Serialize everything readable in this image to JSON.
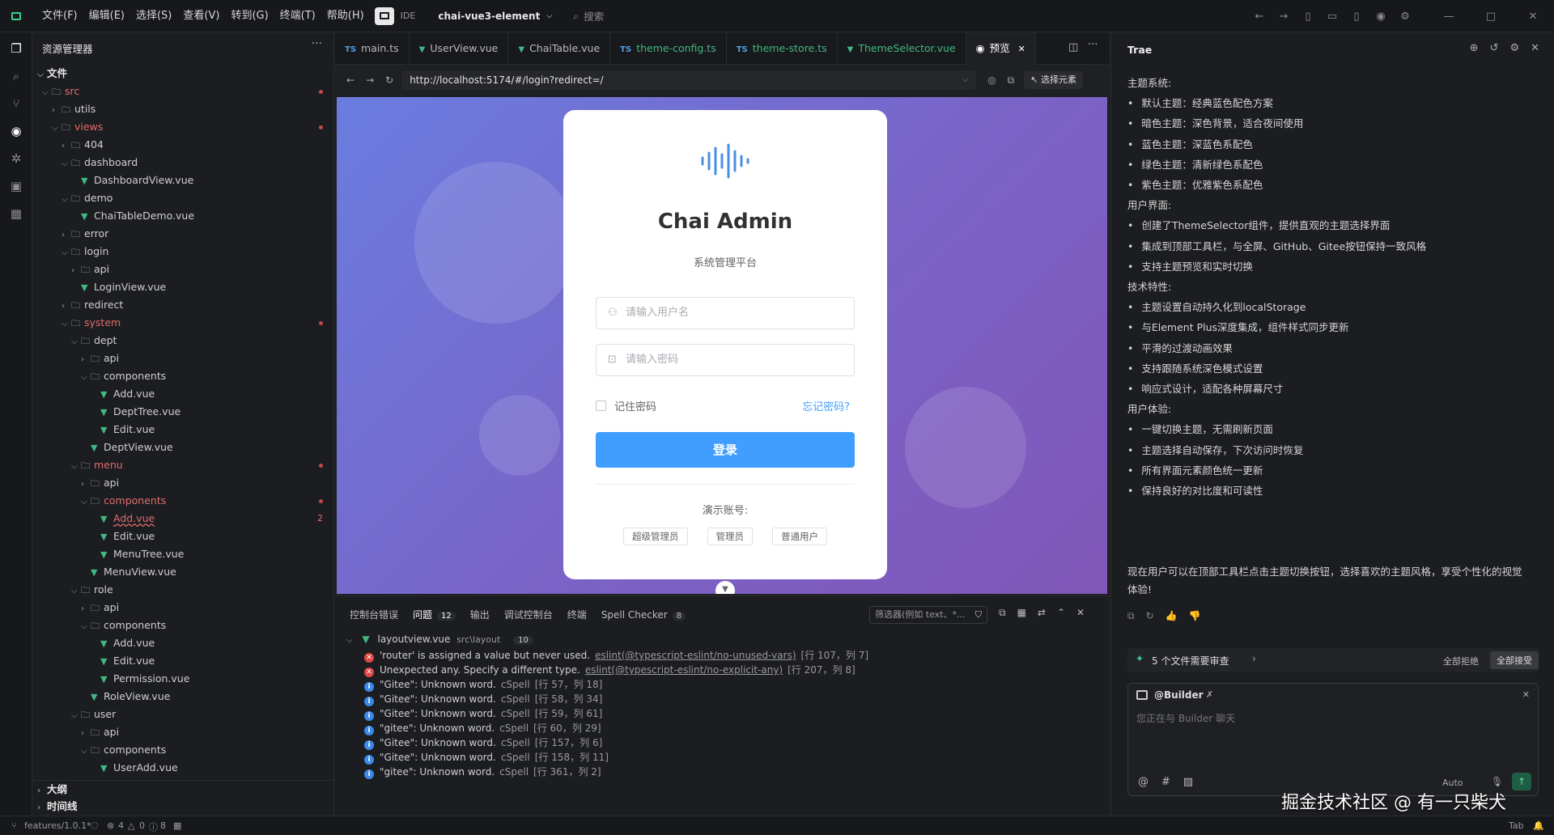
{
  "titlebar": {
    "menus": [
      "文件(F)",
      "编辑(E)",
      "选择(S)",
      "查看(V)",
      "转到(G)",
      "终端(T)",
      "帮助(H)"
    ],
    "ide_label": "IDE",
    "project": "chai-vue3-element",
    "search_placeholder": "搜索"
  },
  "explorer": {
    "title": "资源管理器",
    "section_files": "文件",
    "section_outline": "大纲",
    "section_timeline": "时间线",
    "items": [
      {
        "label": "src",
        "depth": 0,
        "type": "folder",
        "open": true,
        "red": true,
        "dot": true
      },
      {
        "label": "utils",
        "depth": 1,
        "type": "folder",
        "open": false
      },
      {
        "label": "views",
        "depth": 1,
        "type": "folder",
        "open": true,
        "red": true,
        "dot": true
      },
      {
        "label": "404",
        "depth": 2,
        "type": "folder",
        "open": false
      },
      {
        "label": "dashboard",
        "depth": 2,
        "type": "folder",
        "open": true
      },
      {
        "label": "DashboardView.vue",
        "depth": 3,
        "type": "vue"
      },
      {
        "label": "demo",
        "depth": 2,
        "type": "folder",
        "open": true
      },
      {
        "label": "ChaiTableDemo.vue",
        "depth": 3,
        "type": "vue"
      },
      {
        "label": "error",
        "depth": 2,
        "type": "folder",
        "open": false
      },
      {
        "label": "login",
        "depth": 2,
        "type": "folder",
        "open": true
      },
      {
        "label": "api",
        "depth": 3,
        "type": "folder",
        "open": false
      },
      {
        "label": "LoginView.vue",
        "depth": 3,
        "type": "vue"
      },
      {
        "label": "redirect",
        "depth": 2,
        "type": "folder",
        "open": false
      },
      {
        "label": "system",
        "depth": 2,
        "type": "folder",
        "open": true,
        "red": true,
        "dot": true
      },
      {
        "label": "dept",
        "depth": 3,
        "type": "folder",
        "open": true
      },
      {
        "label": "api",
        "depth": 4,
        "type": "folder",
        "open": false
      },
      {
        "label": "components",
        "depth": 4,
        "type": "folder",
        "open": true
      },
      {
        "label": "Add.vue",
        "depth": 5,
        "type": "vue"
      },
      {
        "label": "DeptTree.vue",
        "depth": 5,
        "type": "vue"
      },
      {
        "label": "Edit.vue",
        "depth": 5,
        "type": "vue"
      },
      {
        "label": "DeptView.vue",
        "depth": 4,
        "type": "vue"
      },
      {
        "label": "menu",
        "depth": 3,
        "type": "folder",
        "open": true,
        "red": true,
        "dot": true
      },
      {
        "label": "api",
        "depth": 4,
        "type": "folder",
        "open": false
      },
      {
        "label": "components",
        "depth": 4,
        "type": "folder",
        "open": true,
        "red": true,
        "dot": true
      },
      {
        "label": "Add.vue",
        "depth": 5,
        "type": "vue",
        "red": true,
        "badge": "2"
      },
      {
        "label": "Edit.vue",
        "depth": 5,
        "type": "vue"
      },
      {
        "label": "MenuTree.vue",
        "depth": 5,
        "type": "vue"
      },
      {
        "label": "MenuView.vue",
        "depth": 4,
        "type": "vue"
      },
      {
        "label": "role",
        "depth": 3,
        "type": "folder",
        "open": true
      },
      {
        "label": "api",
        "depth": 4,
        "type": "folder",
        "open": false
      },
      {
        "label": "components",
        "depth": 4,
        "type": "folder",
        "open": true
      },
      {
        "label": "Add.vue",
        "depth": 5,
        "type": "vue"
      },
      {
        "label": "Edit.vue",
        "depth": 5,
        "type": "vue"
      },
      {
        "label": "Permission.vue",
        "depth": 5,
        "type": "vue"
      },
      {
        "label": "RoleView.vue",
        "depth": 4,
        "type": "vue"
      },
      {
        "label": "user",
        "depth": 3,
        "type": "folder",
        "open": true
      },
      {
        "label": "api",
        "depth": 4,
        "type": "folder",
        "open": false
      },
      {
        "label": "components",
        "depth": 4,
        "type": "folder",
        "open": true
      },
      {
        "label": "UserAdd.vue",
        "depth": 5,
        "type": "vue"
      }
    ]
  },
  "tabs": [
    {
      "label": "main.ts",
      "kind": "ts",
      "state": "normal"
    },
    {
      "label": "UserView.vue",
      "kind": "vue",
      "state": "normal"
    },
    {
      "label": "ChaiTable.vue",
      "kind": "vue",
      "state": "normal"
    },
    {
      "label": "theme-config.ts",
      "kind": "ts",
      "state": "modified"
    },
    {
      "label": "theme-store.ts",
      "kind": "ts",
      "state": "modified"
    },
    {
      "label": "ThemeSelector.vue",
      "kind": "vue",
      "state": "modified"
    },
    {
      "label": "预览",
      "kind": "preview",
      "state": "active"
    }
  ],
  "browser": {
    "url": "http://localhost:5174/#/login?redirect=/",
    "select_element": "选择元素"
  },
  "login": {
    "title": "Chai Admin",
    "subtitle": "系统管理平台",
    "username_placeholder": "请输入用户名",
    "password_placeholder": "请输入密码",
    "remember": "记住密码",
    "forgot": "忘记密码?",
    "submit": "登录",
    "demo_title": "演示账号:",
    "demo_accounts": [
      "超级管理员",
      "管理员",
      "普通用户"
    ]
  },
  "panel": {
    "tabs": [
      {
        "label": "控制台错误",
        "badge": ""
      },
      {
        "label": "问题",
        "badge": "12"
      },
      {
        "label": "输出",
        "badge": ""
      },
      {
        "label": "调试控制台",
        "badge": ""
      },
      {
        "label": "终端",
        "badge": ""
      },
      {
        "label": "Spell Checker",
        "badge": "8"
      }
    ],
    "filter_placeholder": "筛选器(例如 text、*...",
    "group": {
      "file": "layoutview.vue",
      "path": "src\\layout",
      "count": "10"
    },
    "problems": [
      {
        "kind": "error",
        "msg": "'router' is assigned a value but never used.",
        "source": "eslint(@typescript-eslint/no-unused-vars)",
        "loc": "[行 107，列 7]"
      },
      {
        "kind": "error",
        "msg": "Unexpected any. Specify a different type.",
        "source": "eslint(@typescript-eslint/no-explicit-any)",
        "loc": "[行 207，列 8]"
      },
      {
        "kind": "info",
        "msg": "\"Gitee\": Unknown word.",
        "source": "cSpell",
        "loc": "[行 57，列 18]"
      },
      {
        "kind": "info",
        "msg": "\"Gitee\": Unknown word.",
        "source": "cSpell",
        "loc": "[行 58，列 34]"
      },
      {
        "kind": "info",
        "msg": "\"Gitee\": Unknown word.",
        "source": "cSpell",
        "loc": "[行 59，列 61]"
      },
      {
        "kind": "info",
        "msg": "\"gitee\": Unknown word.",
        "source": "cSpell",
        "loc": "[行 60，列 29]"
      },
      {
        "kind": "info",
        "msg": "\"Gitee\": Unknown word.",
        "source": "cSpell",
        "loc": "[行 157，列 6]"
      },
      {
        "kind": "info",
        "msg": "\"Gitee\": Unknown word.",
        "source": "cSpell",
        "loc": "[行 158，列 11]"
      },
      {
        "kind": "info",
        "msg": "\"gitee\": Unknown word.",
        "source": "cSpell",
        "loc": "[行 361，列 2]"
      }
    ]
  },
  "chat": {
    "title": "Trae",
    "lines": [
      {
        "t": "主题系统:",
        "b": false
      },
      {
        "t": "默认主题：经典蓝色配色方案",
        "b": true
      },
      {
        "t": "暗色主题：深色背景，适合夜间使用",
        "b": true
      },
      {
        "t": "蓝色主题：深蓝色系配色",
        "b": true
      },
      {
        "t": "绿色主题：清新绿色系配色",
        "b": true
      },
      {
        "t": "紫色主题：优雅紫色系配色",
        "b": true
      },
      {
        "t": "用户界面:",
        "b": false
      },
      {
        "t": "创建了ThemeSelector组件，提供直观的主题选择界面",
        "b": true
      },
      {
        "t": "集成到顶部工具栏，与全屏、GitHub、Gitee按钮保持一致风格",
        "b": true
      },
      {
        "t": "支持主题预览和实时切换",
        "b": true
      },
      {
        "t": "技术特性:",
        "b": false
      },
      {
        "t": "主题设置自动持久化到localStorage",
        "b": true
      },
      {
        "t": "与Element Plus深度集成，组件样式同步更新",
        "b": true
      },
      {
        "t": "平滑的过渡动画效果",
        "b": true
      },
      {
        "t": "支持跟随系统深色模式设置",
        "b": true
      },
      {
        "t": "响应式设计，适配各种屏幕尺寸",
        "b": true
      },
      {
        "t": "用户体验:",
        "b": false
      },
      {
        "t": "一键切换主题，无需刷新页面",
        "b": true
      },
      {
        "t": "主题选择自动保存，下次访问时恢复",
        "b": true
      },
      {
        "t": "所有界面元素颜色统一更新",
        "b": true
      },
      {
        "t": "保持良好的对比度和可读性",
        "b": true
      }
    ],
    "closing_1": "现在用户可以在顶部工具栏点击主题切换按钮，选择喜欢的主题风格，享受个性化的视觉",
    "closing_2": "体验!",
    "review_label": "5 个文件需要审查",
    "reject_all": "全部拒绝",
    "accept_all": "全部接受",
    "builder_label": "@Builder",
    "input_placeholder": "您正在与 Builder 聊天",
    "model": "Auto",
    "watermark": "掘金技术社区 @ 有一只柴犬"
  },
  "statusbar": {
    "branch": "features/1.0.1*",
    "errors": "4",
    "warnings": "0",
    "infos": "8",
    "tab": "Tab"
  }
}
